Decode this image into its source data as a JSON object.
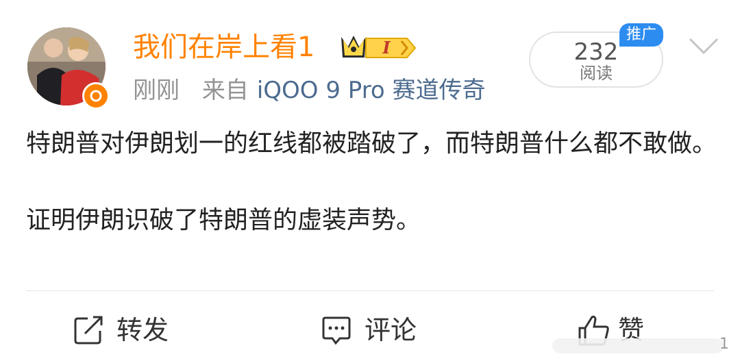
{
  "post": {
    "username": "我们在岸上看1",
    "vip_level": "I",
    "time": "刚刚",
    "source_prefix": "来自",
    "source_device": "iQOO 9 Pro 赛道传奇",
    "read_count": "232",
    "read_label": "阅读",
    "promo_tag": "推广",
    "paragraphs": [
      "特朗普对伊朗划一的红线都被踏破了，而特朗普什么都不敢做。",
      "证明伊朗识破了特朗普的虚装声势。"
    ]
  },
  "actions": {
    "repost_label": "转发",
    "comment_label": "评论",
    "like_label": "赞"
  },
  "overlay": {
    "number": "1"
  },
  "colors": {
    "username": "#ff8200",
    "device": "#4c6b8f",
    "promo": "#2d8cf0"
  }
}
